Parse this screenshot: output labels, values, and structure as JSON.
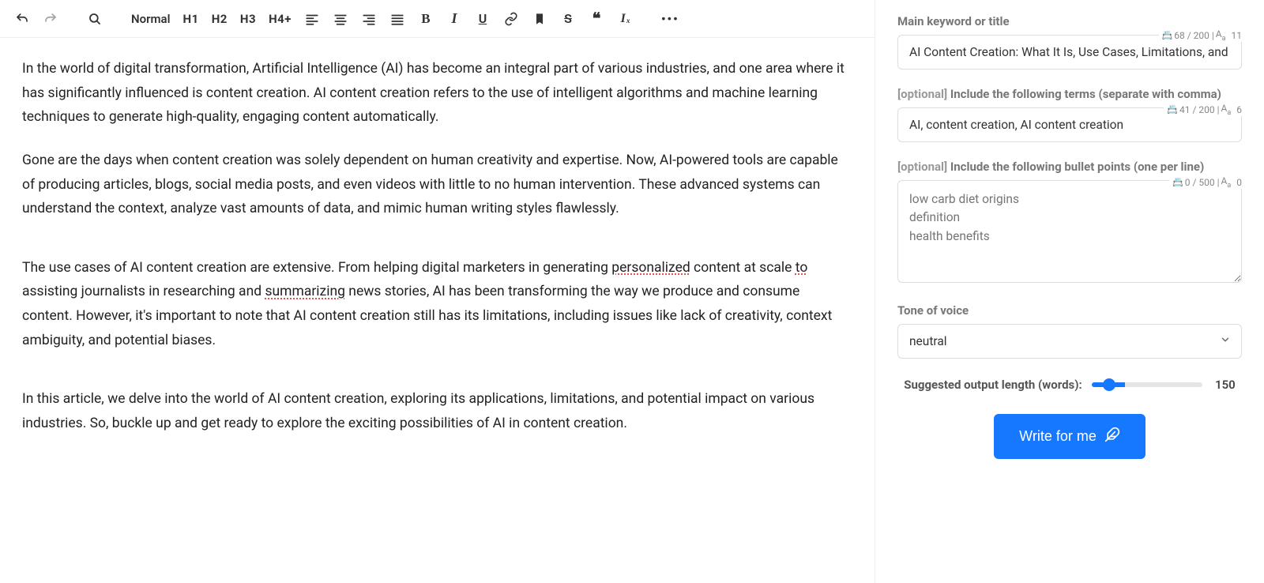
{
  "toolbar": {
    "normal": "Normal",
    "h1": "H1",
    "h2": "H2",
    "h3": "H3",
    "h4plus": "H4+",
    "bold": "B",
    "italic": "I",
    "underline": "U",
    "strike": "S",
    "quote": "❝",
    "clearfmt": "I",
    "clearfmt_x": "x"
  },
  "editor": {
    "p1": "In the world of digital transformation, Artificial Intelligence (AI) has become an integral part of various industries, and one area where it has significantly influenced is content creation. AI content creation refers to the use of intelligent algorithms and machine learning techniques to generate high-quality, engaging content automatically.",
    "p2": "Gone are the days when content creation was solely dependent on human creativity and expertise. Now, AI-powered tools are capable of producing articles, blogs, social media posts, and even videos with little to no human intervention. These advanced systems can understand the context, analyze vast amounts of data, and mimic human writing styles flawlessly.",
    "p3_a": "The use cases of AI content creation are extensive. From helping digital marketers in generating ",
    "p3_m1": "personalized",
    "p3_b": " content at scale ",
    "p3_m2": "to",
    "p3_c": " assisting journalists in researching and ",
    "p3_m3": "summarizing",
    "p3_d": " news stories, AI has been transforming the way we produce and consume content. However, it's important to note that AI content creation still has its limitations, including issues like lack of creativity, context ambiguity, and potential biases.",
    "p4": "In this article, we delve into the world of AI content creation, exploring its applications, limitations, and potential impact on various industries. So, buckle up and get ready to explore the exciting possibilities of AI in content creation."
  },
  "panel": {
    "keyword": {
      "label": "Main keyword or title",
      "counter": "68 / 200 | ",
      "wordcount": "11",
      "value": "AI Content Creation: What It Is, Use Cases, Limitations, and"
    },
    "terms": {
      "label_optional": "[optional]",
      "label": " Include the following terms (separate with comma)",
      "counter": "41 / 200 | ",
      "wordcount": "6",
      "value": "AI, content creation, AI content creation"
    },
    "bullets": {
      "label_optional": "[optional]",
      "label": " Include the following bullet points (one per line)",
      "counter": "0 / 500 | ",
      "wordcount": "0",
      "placeholder": "low carb diet origins\ndefinition\nhealth benefits"
    },
    "tone": {
      "label": "Tone of voice",
      "value": "neutral"
    },
    "length": {
      "label": "Suggested output length (words):",
      "value": "150",
      "min": "50",
      "max": "500"
    },
    "cta": "Write for me"
  }
}
